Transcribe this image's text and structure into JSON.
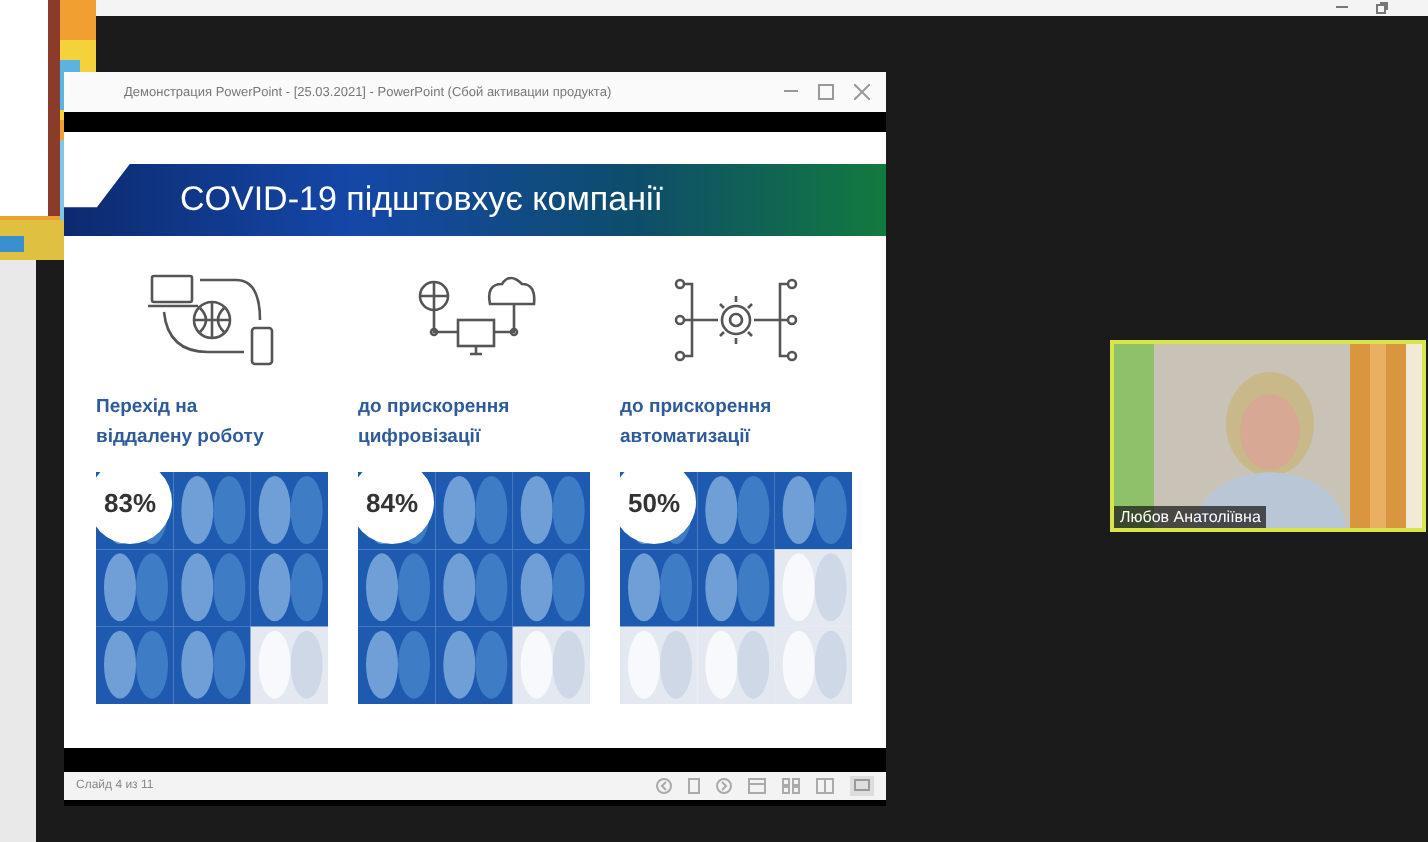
{
  "shared_window": {
    "title": "Демонстрация PowerPoint - [25.03.2021] - PowerPoint (Сбой активации продукта)",
    "slide": {
      "title": "COVID-19 підштовхує компанії",
      "columns": [
        {
          "kind": "devices",
          "label": "Перехід на віддалену роботу",
          "percent": "83%"
        },
        {
          "kind": "network",
          "label": "до прискорення цифровізації",
          "percent": "84%"
        },
        {
          "kind": "automation",
          "label": "до прискорення автоматизації",
          "percent": "50%"
        }
      ]
    },
    "status_bar": {
      "slide_counter": "Слайд 4 из 11"
    }
  },
  "video_tile": {
    "name": "Любов Анатоліївна",
    "speaking": true
  }
}
